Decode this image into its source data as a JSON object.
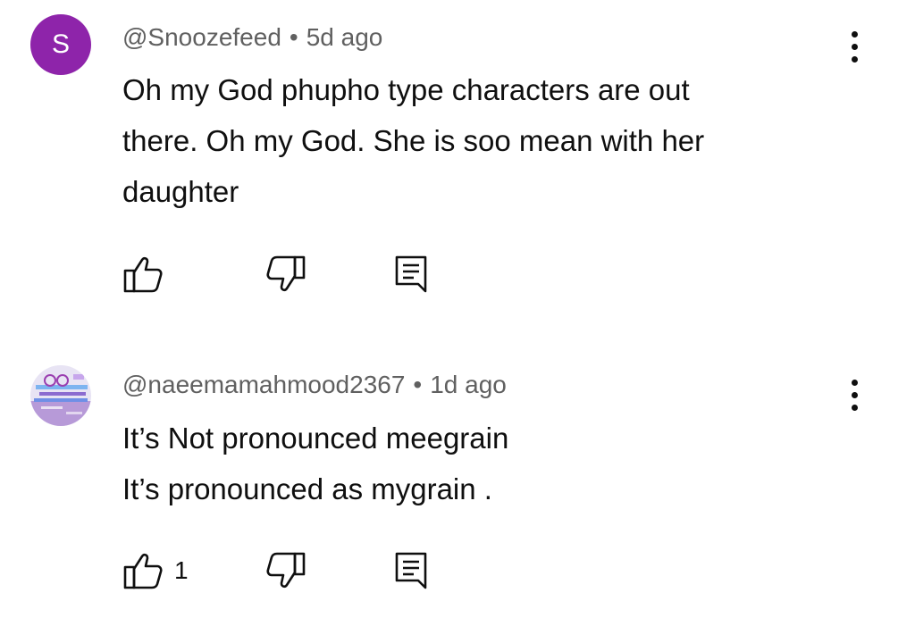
{
  "comments": [
    {
      "avatar_letter": "S",
      "avatar_color": "#8e24aa",
      "author": "@Snoozefeed",
      "separator": "•",
      "time": "5d ago",
      "lines": [
        "Oh my God phupho type characters are out",
        "there. Oh my God. She is soo mean with her",
        "daughter"
      ],
      "like_count": "",
      "icons": {
        "like": "thumbs-up-icon",
        "dislike": "thumbs-down-icon",
        "reply": "reply-comment-icon",
        "more": "more-vertical-icon"
      }
    },
    {
      "avatar_letter": "",
      "author": "@naeemamahmood2367",
      "separator": "•",
      "time": "1d ago",
      "lines": [
        "It’s Not pronounced meegrain",
        "It’s pronounced as mygrain ."
      ],
      "like_count": "1",
      "icons": {
        "like": "thumbs-up-icon",
        "dislike": "thumbs-down-icon",
        "reply": "reply-comment-icon",
        "more": "more-vertical-icon"
      }
    }
  ]
}
